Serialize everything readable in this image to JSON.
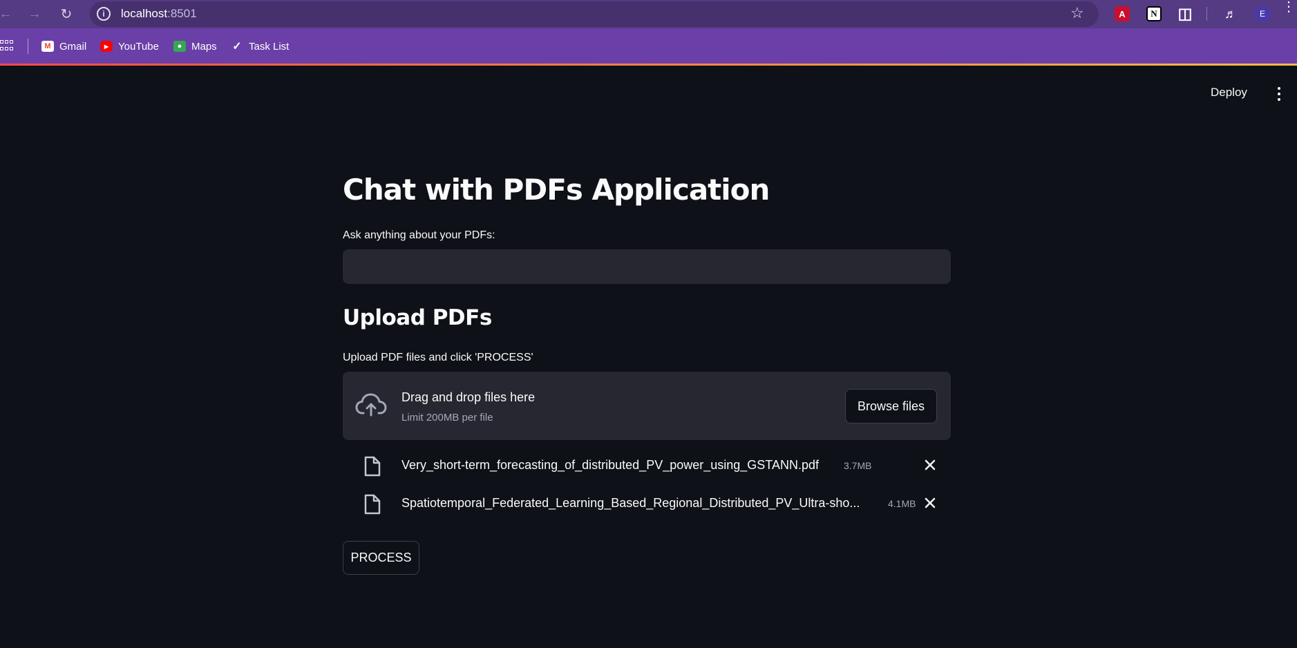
{
  "browser": {
    "url_host": "localhost",
    "url_port": ":8501",
    "avatar_letter": "E",
    "bookmarks": [
      {
        "label": "Gmail",
        "icon": "gmail-icon"
      },
      {
        "label": "YouTube",
        "icon": "youtube-icon"
      },
      {
        "label": "Maps",
        "icon": "maps-icon"
      },
      {
        "label": "Task List",
        "icon": "checkmark-icon"
      }
    ]
  },
  "header": {
    "deploy_label": "Deploy"
  },
  "main": {
    "title": "Chat with PDFs Application",
    "ask_label": "Ask anything about your PDFs:",
    "ask_value": "",
    "upload_title": "Upload PDFs",
    "upload_label": "Upload PDF files and click 'PROCESS'",
    "dropzone": {
      "title": "Drag and drop files here",
      "limit": "Limit 200MB per file",
      "browse_label": "Browse files"
    },
    "files": [
      {
        "name": "Very_short-term_forecasting_of_distributed_PV_power_using_GSTANN.pdf",
        "size": "3.7MB"
      },
      {
        "name": "Spatiotemporal_Federated_Learning_Based_Regional_Distributed_PV_Ultra-sho...",
        "size": "4.1MB"
      }
    ],
    "process_label": "PROCESS"
  },
  "colors": {
    "background": "#0e1117",
    "input_bg": "#262730",
    "chrome": "#553a84",
    "bookmarks_bar": "#6a3fa8",
    "accent_line": "#ff4b4b"
  }
}
